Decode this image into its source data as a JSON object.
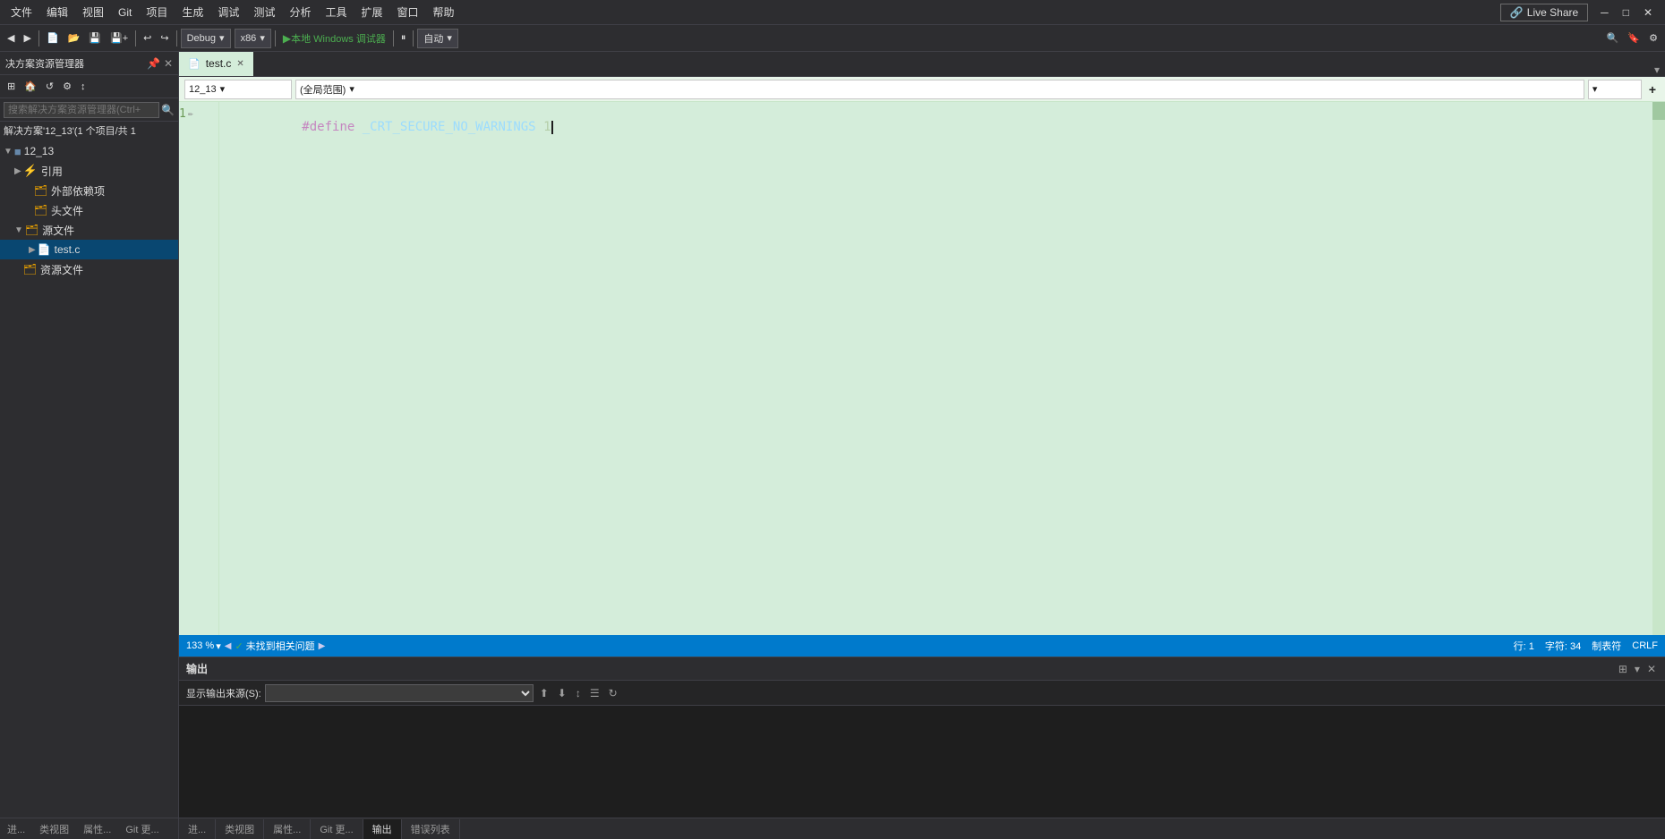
{
  "menubar": {
    "items": [
      "文件",
      "编辑",
      "视图",
      "Git",
      "项目",
      "生成",
      "调试",
      "测试",
      "分析",
      "工具",
      "扩展",
      "窗口",
      "帮助"
    ]
  },
  "toolbar": {
    "back_label": "◀",
    "forward_label": "▶",
    "debug_config": "Debug",
    "platform": "x86",
    "run_label": "▶ 本地 Windows 调试器",
    "auto_label": "自动"
  },
  "liveshare": {
    "label": "Live Share"
  },
  "sidebar": {
    "header_title": "决方案资源管理器",
    "toolbar_icons": [
      "⊞",
      "↺",
      "📋",
      "↕"
    ],
    "search_placeholder": "搜索解决方案资源管理器(Ctrl+",
    "solution_label": "解决方案'12_13'(1 个项目/共 1",
    "tree": [
      {
        "level": 0,
        "arrow": "▲",
        "icon": "■",
        "label": "12_13",
        "type": "project"
      },
      {
        "level": 1,
        "arrow": "▶",
        "icon": "⚡",
        "label": "引用",
        "type": "folder"
      },
      {
        "level": 2,
        "arrow": "",
        "icon": "📁",
        "label": "外部依赖项",
        "type": "folder"
      },
      {
        "level": 2,
        "arrow": "",
        "icon": "📁",
        "label": "头文件",
        "type": "folder"
      },
      {
        "level": 1,
        "arrow": "▼",
        "icon": "📁",
        "label": "源文件",
        "type": "folder",
        "expanded": true
      },
      {
        "level": 2,
        "arrow": "▶",
        "icon": "📄",
        "label": "test.c",
        "type": "file",
        "selected": true
      },
      {
        "level": 1,
        "arrow": "",
        "icon": "📁",
        "label": "资源文件",
        "type": "folder"
      }
    ],
    "bottom_tabs": [
      "进...",
      "类视图",
      "属性...",
      "Git 更..."
    ]
  },
  "editor": {
    "tabs": [
      {
        "label": "test.c",
        "active": true,
        "modified": false
      },
      {
        "label": "",
        "active": false
      }
    ],
    "nav": {
      "location": "12_13",
      "scope": "(全局范围)"
    },
    "lines": [
      {
        "num": "1",
        "has_pencil": true,
        "content": "#define _CRT_SECURE_NO_WARNINGS 1",
        "has_cursor": true
      }
    ],
    "status": {
      "zoom": "133 %",
      "no_issues": "未找到相关问题",
      "row": "行: 1",
      "col": "字符: 34",
      "line_ending": "制表符",
      "encoding": "CRLF"
    }
  },
  "output_panel": {
    "title": "输出",
    "source_label": "显示输出来源(S):",
    "close_label": "✕",
    "float_label": "⊞"
  },
  "bottom_tabs": {
    "items": [
      "进...",
      "类视图",
      "属性...",
      "Git 更...",
      "输出",
      "错误列表"
    ]
  }
}
